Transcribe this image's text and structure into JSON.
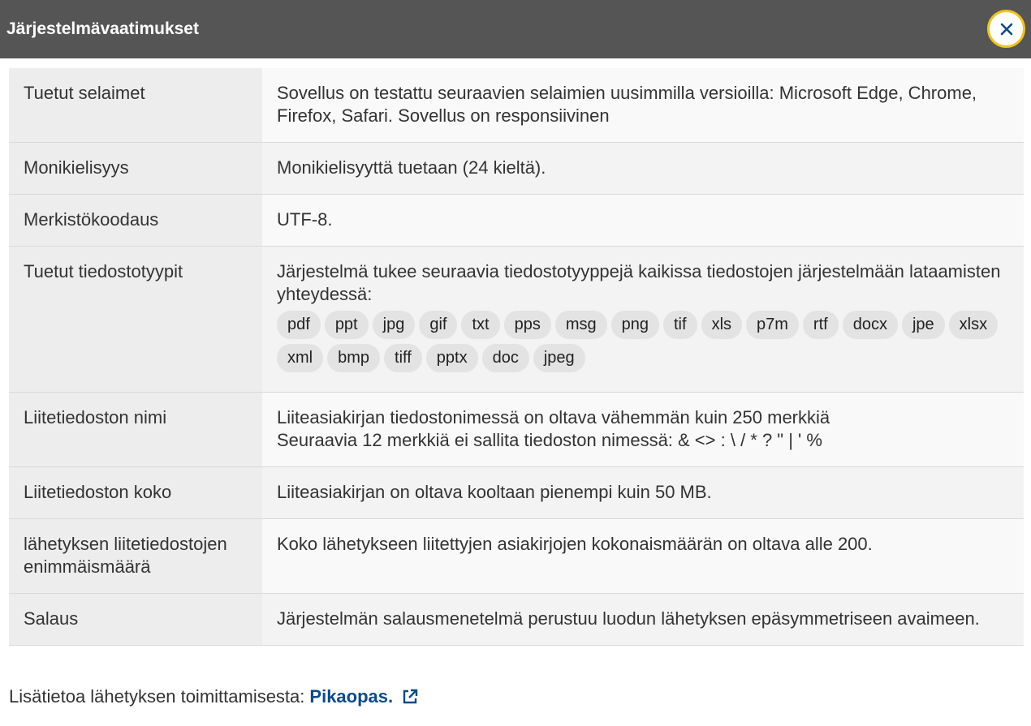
{
  "dialog": {
    "title": "Järjestelmävaatimukset",
    "close_icon": "close-icon"
  },
  "rows": [
    {
      "label": "Tuetut selaimet",
      "lines": [
        "Sovellus on testattu seuraavien selaimien uusimmilla versioilla: Microsoft Edge, Chrome, Firefox, Safari. Sovellus on responsiivinen"
      ]
    },
    {
      "label": "Monikielisyys",
      "lines": [
        "Monikielisyyttä tuetaan (24 kieltä)."
      ]
    },
    {
      "label": "Merkistökoodaus",
      "lines": [
        "UTF-8."
      ]
    },
    {
      "label": "Tuetut tiedostotyypit",
      "lines": [
        "Järjestelmä tukee seuraavia tiedostotyyppejä kaikissa tiedostojen järjestelmään lataamisten yhteydessä:"
      ],
      "tags": [
        "pdf",
        "ppt",
        "jpg",
        "gif",
        "txt",
        "pps",
        "msg",
        "png",
        "tif",
        "xls",
        "p7m",
        "rtf",
        "docx",
        "jpe",
        "xlsx",
        "xml",
        "bmp",
        "tiff",
        "pptx",
        "doc",
        "jpeg"
      ]
    },
    {
      "label": "Liitetiedoston nimi",
      "lines": [
        "Liiteasiakirjan tiedostonimessä on oltava vähemmän kuin 250 merkkiä",
        "Seuraavia 12 merkkiä ei sallita tiedoston nimessä: & <> : \\ / * ? \" | ' %"
      ]
    },
    {
      "label": "Liitetiedoston koko",
      "lines": [
        "Liiteasiakirjan on oltava kooltaan pienempi kuin 50 MB."
      ]
    },
    {
      "label": "lähetyksen liitetiedostojen enimmäismäärä",
      "lines": [
        "Koko lähetykseen liitettyjen asiakirjojen kokonaismäärän on oltava alle 200."
      ]
    },
    {
      "label": "Salaus",
      "lines": [
        "Järjestelmän salausmenetelmä perustuu luodun lähetyksen epäsymmetriseen avaimeen."
      ]
    }
  ],
  "footer": {
    "text": "Lisätietoa lähetyksen toimittamisesta:",
    "link_label": "Pikaopas.",
    "link_icon": "external-link-icon"
  },
  "colors": {
    "header_bg": "#555555",
    "close_border": "#f2c31b",
    "link": "#0b4a8b"
  }
}
